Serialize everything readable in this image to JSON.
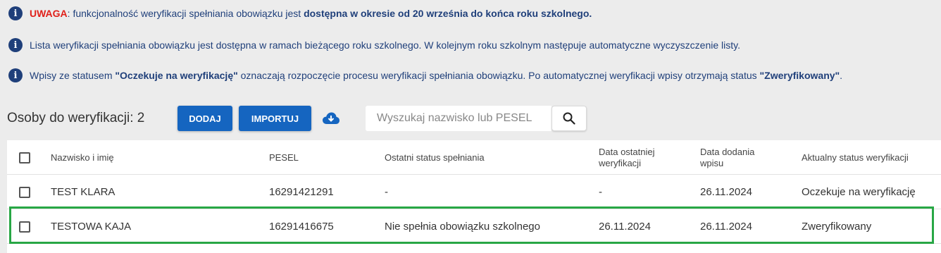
{
  "notices": {
    "n1": {
      "warning": "UWAGA",
      "text": ": funkcjonalność weryfikacji spełniania obowiązku jest ",
      "bold": "dostępna w okresie od 20 września do końca roku szkolnego."
    },
    "n2": {
      "text": "Lista weryfikacji spełniania obowiązku jest dostępna w ramach bieżącego roku szkolnego. W kolejnym roku szkolnym następuje automatyczne wyczyszczenie listy."
    },
    "n3": {
      "t1": "Wpisy ze statusem ",
      "b1": "\"Oczekuje na weryfikację\"",
      "t2": " oznaczają rozpoczęcie procesu weryfikacji spełniania obowiązku. Po automatycznej weryfikacji wpisy otrzymają status ",
      "b2": "\"Zweryfikowany\"",
      "t3": "."
    }
  },
  "toolbar": {
    "title": "Osoby do weryfikacji: 2",
    "add_label": "DODAJ",
    "import_label": "IMPORTUJ",
    "download_icon": "cloud-download-icon",
    "search_placeholder": "Wyszukaj nazwisko lub PESEL",
    "search_icon": "search-icon"
  },
  "table": {
    "headers": {
      "name": "Nazwisko i imię",
      "pesel": "PESEL",
      "last_status": "Ostatni status spełniania",
      "last_verification_1": "Data ostatniej",
      "last_verification_2": "weryfikacji",
      "date_added_1": "Data dodania",
      "date_added_2": "wpisu",
      "current_status": "Aktualny status weryfikacji"
    },
    "rows": [
      {
        "name": "TEST KLARA",
        "pesel": "16291421291",
        "last_status": "-",
        "last_verification": "-",
        "date_added": "26.11.2024",
        "current_status": "Oczekuje na weryfikację"
      },
      {
        "name": "TESTOWA KAJA",
        "pesel": "16291416675",
        "last_status": "Nie spełnia obowiązku szkolnego",
        "last_verification": "26.11.2024",
        "date_added": "26.11.2024",
        "current_status": "Zweryfikowany"
      }
    ]
  },
  "colors": {
    "primary": "#1565c0",
    "notice_text": "#1f3f7a",
    "warning": "#e0201a",
    "highlight": "#28a745"
  }
}
